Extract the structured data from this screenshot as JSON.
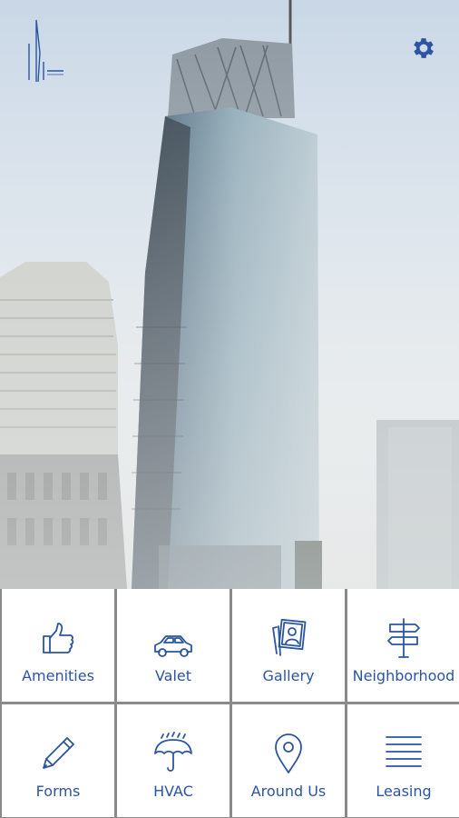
{
  "hero": {
    "background": "building-photo"
  },
  "brand": {
    "logo_icon": "tower-logo-icon",
    "accent": "#2b55a4"
  },
  "header": {
    "settings_icon": "gear-icon"
  },
  "tiles": [
    {
      "label": "Amenities",
      "icon": "thumbs-up-icon"
    },
    {
      "label": "Valet",
      "icon": "car-icon"
    },
    {
      "label": "Gallery",
      "icon": "photo-gallery-icon"
    },
    {
      "label": "Neighborhood",
      "icon": "signpost-icon"
    },
    {
      "label": "Forms",
      "icon": "pencil-icon"
    },
    {
      "label": "HVAC",
      "icon": "umbrella-icon"
    },
    {
      "label": "Around Us",
      "icon": "location-pin-icon"
    },
    {
      "label": "Leasing",
      "icon": "lines-icon"
    }
  ]
}
